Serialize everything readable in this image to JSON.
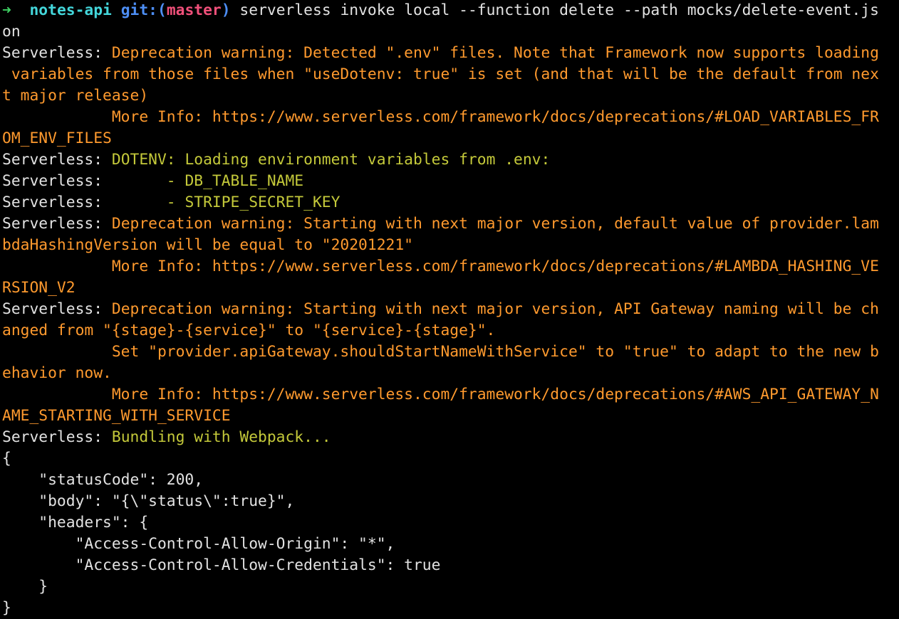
{
  "prompt": {
    "arrow": "➜",
    "directory": "notes-api",
    "git_label": "git:(",
    "branch": "master",
    "git_close": ")",
    "command": "serverless invoke local --function delete --path mocks/delete-event.js",
    "command_wrap": "on"
  },
  "colors": {
    "background": "#000000",
    "foreground": "#e2e2e2",
    "warning": "#ff9a2e",
    "info": "#c4c93a",
    "prompt_arrow": "#3ed163",
    "directory": "#43d6da",
    "git": "#4d8ef5",
    "branch": "#f0507a"
  },
  "output": {
    "prefix": "Serverless: ",
    "indent_prefix": "Serverless:      ",
    "dotenv_warn_1": "Deprecation warning: Detected \".env\" files. Note that Framework now supports loading",
    "dotenv_warn_2": " variables from those files when \"useDotenv: true\" is set (and that will be the default from nex",
    "dotenv_warn_3": "t major release)",
    "dotenv_info_1": "            More Info: https://www.serverless.com/framework/docs/deprecations/#LOAD_VARIABLES_FR",
    "dotenv_info_2": "OM_ENV_FILES",
    "dotenv_loading": "DOTENV: Loading environment variables from .env:",
    "env_var_1": " - DB_TABLE_NAME",
    "env_var_2": " - STRIPE_SECRET_KEY",
    "lambda_warn_1": "Deprecation warning: Starting with next major version, default value of provider.lam",
    "lambda_warn_2": "bdaHashingVersion will be equal to \"20201221\"",
    "lambda_info_1": "            More Info: https://www.serverless.com/framework/docs/deprecations/#LAMBDA_HASHING_VE",
    "lambda_info_2": "RSION_V2",
    "apigw_warn_1": "Deprecation warning: Starting with next major version, API Gateway naming will be ch",
    "apigw_warn_2": "anged from \"{stage}-{service}\" to \"{service}-{stage}\".",
    "apigw_set_1": "            Set \"provider.apiGateway.shouldStartNameWithService\" to \"true\" to adapt to the new b",
    "apigw_set_2": "ehavior now.",
    "apigw_info_1": "            More Info: https://www.serverless.com/framework/docs/deprecations/#AWS_API_GATEWAY_N",
    "apigw_info_2": "AME_STARTING_WITH_SERVICE",
    "bundling": "Bundling with Webpack..."
  },
  "result": {
    "open_brace": "{",
    "status_code": "    \"statusCode\": 200,",
    "body": "    \"body\": \"{\\\"status\\\":true}\",",
    "headers_open": "    \"headers\": {",
    "allow_origin": "        \"Access-Control-Allow-Origin\": \"*\",",
    "allow_credentials": "        \"Access-Control-Allow-Credentials\": true",
    "headers_close": "    }",
    "close_brace": "}"
  }
}
